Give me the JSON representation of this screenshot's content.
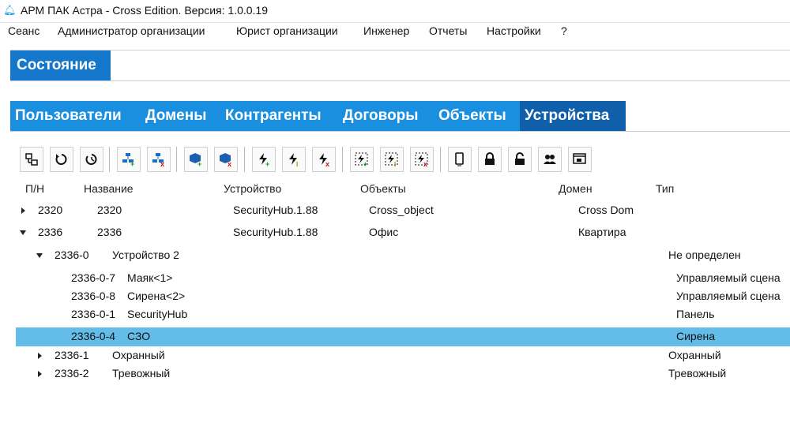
{
  "window": {
    "title": "АРМ ПАК Астра - Cross Edition. Версия: 1.0.0.19"
  },
  "menu": [
    "Сеанс",
    "Администратор организации",
    "Юрист организации",
    "Инженер",
    "Отчеты",
    "Настройки",
    "?"
  ],
  "state_button": "Состояние",
  "tabs": [
    "Пользователи",
    "Домены",
    "Контрагенты",
    "Договоры",
    "Объекты",
    "Устройства"
  ],
  "active_tab": "Устройства",
  "toolbar_icons": [
    "network-device-icon",
    "refresh-icon",
    "refresh-timer-icon",
    "tree-add-icon",
    "tree-remove-icon",
    "cube-add-icon",
    "cube-remove-icon",
    "bolt-add-icon",
    "bolt-edit-icon",
    "bolt-remove-icon",
    "bolt-frame-add-icon",
    "bolt-frame-edit-icon",
    "bolt-frame-remove-icon",
    "phone-icon",
    "lock-closed-icon",
    "lock-open-icon",
    "users-icon",
    "window-icon"
  ],
  "columns": [
    "П/Н",
    "Название",
    "Устройство",
    "Объекты",
    "Домен",
    "Тип"
  ],
  "rows": [
    {
      "id": "2320",
      "name": "2320",
      "device": "SecurityHub.1.88",
      "object": "Cross_object",
      "domain": "Cross Dom",
      "type": ""
    },
    {
      "id": "2336",
      "name": "2336",
      "device": "SecurityHub.1.88",
      "object": "Офис",
      "domain": "Квартира",
      "type": ""
    },
    {
      "id": "2336-0",
      "name": "Устройство 2",
      "device": "",
      "object": "",
      "domain": "",
      "type": "Не определен"
    },
    {
      "id": "2336-0-7",
      "name": "Маяк<1>",
      "device": "",
      "object": "",
      "domain": "",
      "type": "Управляемый сцена"
    },
    {
      "id": "2336-0-8",
      "name": "Сирена<2>",
      "device": "",
      "object": "",
      "domain": "",
      "type": "Управляемый сцена"
    },
    {
      "id": "2336-0-1",
      "name": "SecurityHub",
      "device": "",
      "object": "",
      "domain": "",
      "type": "Панель"
    },
    {
      "id": "2336-0-4",
      "name": "СЗО",
      "device": "",
      "object": "",
      "domain": "",
      "type": "Сирена"
    },
    {
      "id": "2336-1",
      "name": "Охранный",
      "device": "",
      "object": "",
      "domain": "",
      "type": "Охранный"
    },
    {
      "id": "2336-2",
      "name": "Тревожный",
      "device": "",
      "object": "",
      "domain": "",
      "type": "Тревожный"
    }
  ],
  "colors": {
    "tab": "#1a8fe0",
    "tab_active": "#0f5fab",
    "selection": "#64bde8"
  }
}
